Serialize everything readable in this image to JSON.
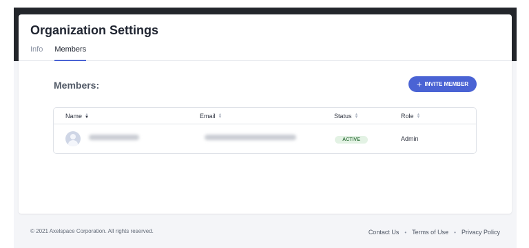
{
  "page": {
    "title": "Organization Settings",
    "tabs": [
      {
        "label": "Info",
        "active": false
      },
      {
        "label": "Members",
        "active": true
      }
    ]
  },
  "members": {
    "heading": "Members:",
    "invite_button": {
      "icon": "plus-icon",
      "label": "INVITE MEMBER"
    },
    "table": {
      "columns": [
        "Name",
        "Email",
        "Status",
        "Role"
      ],
      "rows": [
        {
          "name": "",
          "email": "",
          "status": "ACTIVE",
          "role": "Admin"
        }
      ]
    }
  },
  "footer": {
    "copyright": "© 2021 Axelspace Corporation. All rights reserved.",
    "links": [
      "Contact Us",
      "Terms of Use",
      "Privacy Policy"
    ],
    "separator": "•"
  },
  "colors": {
    "accent": "#4a63d4",
    "status_active_bg": "#e3f2e4",
    "status_active_text": "#3d7a47",
    "dark_band": "#23262b"
  }
}
